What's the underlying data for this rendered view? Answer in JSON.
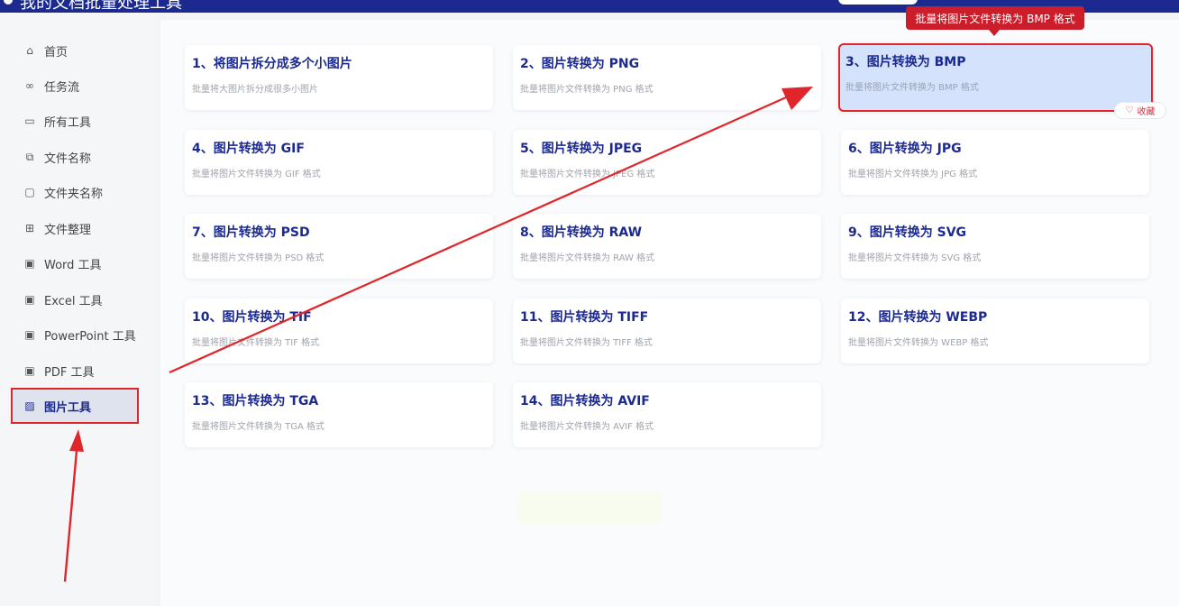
{
  "app": {
    "title": "我的文档批量处理工具"
  },
  "tooltip": "批量将图片文件转换为 BMP 格式",
  "favorite_label": "收藏",
  "sidebar": {
    "items": [
      {
        "label": "首页",
        "icon": "home-icon",
        "glyph": "⌂"
      },
      {
        "label": "任务流",
        "icon": "workflow-icon",
        "glyph": "∞"
      },
      {
        "label": "所有工具",
        "icon": "monitor-icon",
        "glyph": "▭"
      },
      {
        "label": "文件名称",
        "icon": "file-copy-icon",
        "glyph": "⧉"
      },
      {
        "label": "文件夹名称",
        "icon": "folder-icon",
        "glyph": "▢"
      },
      {
        "label": "文件整理",
        "icon": "organize-icon",
        "glyph": "⊞"
      },
      {
        "label": "Word 工具",
        "icon": "word-icon",
        "glyph": "▣"
      },
      {
        "label": "Excel 工具",
        "icon": "excel-icon",
        "glyph": "▣"
      },
      {
        "label": "PowerPoint 工具",
        "icon": "powerpoint-icon",
        "glyph": "▣"
      },
      {
        "label": "PDF 工具",
        "icon": "pdf-icon",
        "glyph": "▣"
      },
      {
        "label": "图片工具",
        "icon": "image-icon",
        "glyph": "▨",
        "active": true
      }
    ]
  },
  "cards": [
    {
      "title": "1、将图片拆分成多个小图片",
      "desc": "批量将大图片拆分成很多小图片"
    },
    {
      "title": "2、图片转换为 PNG",
      "desc": "批量将图片文件转换为 PNG 格式"
    },
    {
      "title": "3、图片转换为 BMP",
      "desc": "批量将图片文件转换为 BMP 格式",
      "highlighted": true
    },
    {
      "title": "4、图片转换为 GIF",
      "desc": "批量将图片文件转换为 GIF 格式"
    },
    {
      "title": "5、图片转换为 JPEG",
      "desc": "批量将图片文件转换为 JPEG 格式"
    },
    {
      "title": "6、图片转换为 JPG",
      "desc": "批量将图片文件转换为 JPG 格式"
    },
    {
      "title": "7、图片转换为 PSD",
      "desc": "批量将图片文件转换为 PSD 格式"
    },
    {
      "title": "8、图片转换为 RAW",
      "desc": "批量将图片文件转换为 RAW 格式"
    },
    {
      "title": "9、图片转换为 SVG",
      "desc": "批量将图片文件转换为 SVG 格式"
    },
    {
      "title": "10、图片转换为 TIF",
      "desc": "批量将图片文件转换为 TIF 格式"
    },
    {
      "title": "11、图片转换为 TIFF",
      "desc": "批量将图片文件转换为 TIFF 格式"
    },
    {
      "title": "12、图片转换为 WEBP",
      "desc": "批量将图片文件转换为 WEBP 格式"
    },
    {
      "title": "13、图片转换为 TGA",
      "desc": "批量将图片文件转换为 TGA 格式"
    },
    {
      "title": "14、图片转换为 AVIF",
      "desc": "批量将图片文件转换为 AVIF 格式"
    }
  ],
  "colors": {
    "topbar": "#1c2a8f",
    "accent": "#1c2a8f",
    "annotation_red": "#e0262b",
    "highlight_bg": "#d4e2fb"
  }
}
